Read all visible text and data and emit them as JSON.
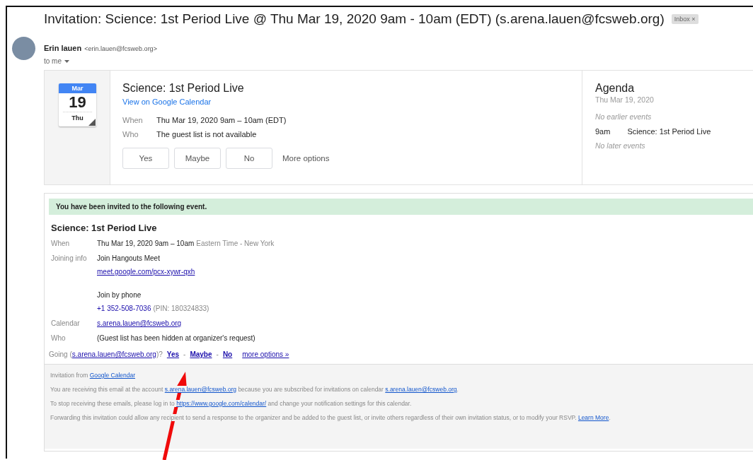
{
  "subject": {
    "text": "Invitation: Science: 1st Period Live @ Thu Mar 19, 2020 9am - 10am (EDT) (s.arena.lauen@fcsweb.org)",
    "chip": "Inbox",
    "chip_close": "×"
  },
  "sender": {
    "name": "Erin lauen",
    "email": "<erin.lauen@fcsweb.org>",
    "recipient": "to me"
  },
  "card": {
    "month": "Mar",
    "day": "19",
    "weekday": "Thu",
    "title": "Science: 1st Period Live",
    "link": "View on Google Calendar",
    "details": [
      {
        "label": "When",
        "value": "Thu Mar 19, 2020 9am – 10am (EDT)"
      },
      {
        "label": "Who",
        "value": "The guest list is not available"
      }
    ],
    "buttons": [
      "Yes",
      "Maybe",
      "No"
    ],
    "more": "More options"
  },
  "agenda": {
    "title": "Agenda",
    "date": "Thu Mar 19, 2020",
    "items": [
      {
        "kind": "note",
        "text": "No earlier events"
      },
      {
        "kind": "event",
        "time": "9am",
        "text": "Science: 1st Period Live"
      },
      {
        "kind": "note",
        "text": "No later events"
      }
    ]
  },
  "invite": {
    "banner": "You have been invited to the following event.",
    "title": "Science: 1st Period Live",
    "rows": [
      {
        "label": "When",
        "blocks": [
          [
            [
              {
                "kind": "text",
                "text": "Thu Mar 19, 2020 9am – 10am"
              },
              {
                "kind": "muted",
                "text": "Eastern Time - New York"
              }
            ]
          ]
        ]
      },
      {
        "label": "Joining info",
        "blocks": [
          [
            [
              {
                "kind": "text",
                "text": "Join Hangouts Meet"
              }
            ],
            [
              {
                "kind": "link",
                "text": "meet.google.com/pcx-xywr-qxh"
              }
            ]
          ],
          [
            [
              {
                "kind": "text",
                "text": "Join by phone"
              }
            ],
            [
              {
                "kind": "phone",
                "text": "+1 352-508-7036"
              },
              {
                "kind": "muted",
                "text": "(PIN: 180324833)"
              }
            ]
          ]
        ]
      },
      {
        "label": "Calendar",
        "blocks": [
          [
            [
              {
                "kind": "link",
                "text": "s.arena.lauen@fcsweb.org"
              }
            ]
          ]
        ]
      },
      {
        "label": "Who",
        "blocks": [
          [
            [
              {
                "kind": "text",
                "text": "(Guest list has been hidden at organizer's request)"
              }
            ]
          ]
        ]
      }
    ],
    "going": [
      {
        "kind": "muted",
        "text": "Going ("
      },
      {
        "kind": "link",
        "text": "s.arena.lauen@fcsweb.org"
      },
      {
        "kind": "muted",
        "text": ")?"
      },
      {
        "kind": "bold-link",
        "text": "Yes"
      },
      {
        "kind": "muted",
        "text": "-"
      },
      {
        "kind": "bold-link",
        "text": "Maybe"
      },
      {
        "kind": "muted",
        "text": "-"
      },
      {
        "kind": "bold-link",
        "text": "No"
      },
      {
        "kind": "link",
        "text": "more options »"
      }
    ]
  },
  "footer": [
    [
      {
        "kind": "muted",
        "text": "Invitation from "
      },
      {
        "kind": "link",
        "text": "Google Calendar"
      }
    ],
    [
      {
        "kind": "muted",
        "text": "You are receiving this email at the account "
      },
      {
        "kind": "link",
        "text": "s.arena.lauen@fcsweb.org"
      },
      {
        "kind": "muted",
        "text": " because you are subscribed for invitations on calendar "
      },
      {
        "kind": "link",
        "text": "s.arena.lauen@fcsweb.org"
      },
      {
        "kind": "muted",
        "text": "."
      }
    ],
    [
      {
        "kind": "muted",
        "text": "To stop receiving these emails, please log in to "
      },
      {
        "kind": "link",
        "text": "https://www.google.com/calendar/"
      },
      {
        "kind": "muted",
        "text": " and change your notification settings for this calendar."
      }
    ],
    [
      {
        "kind": "muted",
        "text": "Forwarding this invitation could allow any recipient to send a response to the organizer and be added to the guest list, or invite others regardless of their own invitation status, or to modify your RSVP. "
      },
      {
        "kind": "link",
        "text": "Learn More"
      },
      {
        "kind": "muted",
        "text": "."
      }
    ]
  ]
}
